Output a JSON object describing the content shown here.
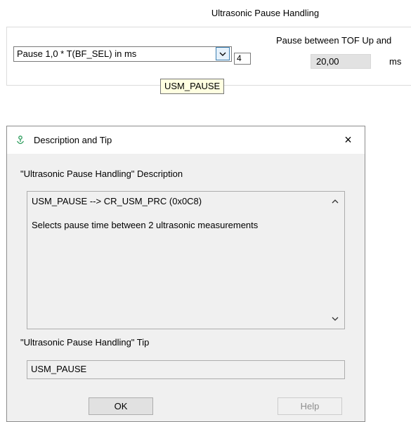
{
  "panel": {
    "section_title": "Ultrasonic Pause Handling",
    "pause_select_value": "Pause 1,0 * T(BF_SEL) in ms",
    "select_index_value": "4",
    "pause_between_label": "Pause between TOF Up and",
    "pause_value": "20,00",
    "pause_unit": "ms",
    "tooltip_text": "USM_PAUSE"
  },
  "dialog": {
    "title": "Description and Tip",
    "close_label": "×",
    "description_heading": "\"Ultrasonic Pause Handling\" Description",
    "description_line1": "USM_PAUSE --> CR_USM_PRC (0x0C8)",
    "description_line2": "Selects pause time between 2 ultrasonic measurements",
    "tip_heading": "\"Ultrasonic Pause Handling\" Tip",
    "tip_value": "USM_PAUSE",
    "ok_label": "OK",
    "help_label": "Help"
  },
  "icons": {
    "dropdown": "chevron-down-icon",
    "app": "app-icon",
    "close": "close-icon",
    "scroll_up": "chevron-up-icon",
    "scroll_down": "chevron-down-icon"
  },
  "colors": {
    "accent": "#3c7fb1",
    "tooltip_bg": "#ffffe1",
    "dialog_bg": "#f0f0f0",
    "icon_green": "#2e9d5d"
  }
}
